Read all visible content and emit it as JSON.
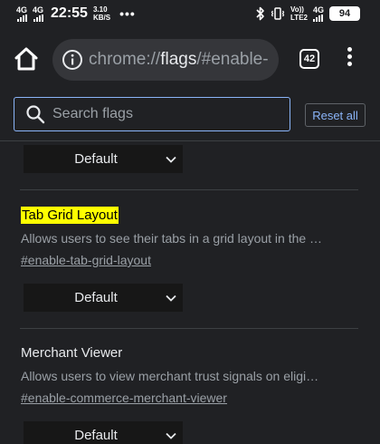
{
  "status_bar": {
    "signal1_label": "4G",
    "signal2_label": "4G",
    "time": "22:55",
    "net_rate_value": "3.10",
    "net_rate_unit": "KB/S",
    "more_dots": "•••",
    "volte_top": "Vo))",
    "volte_bottom": "LTE2",
    "signal3_label": "4G",
    "battery": "94"
  },
  "toolbar": {
    "url_prefix": "chrome://",
    "url_host": "flags",
    "url_suffix": "/#enable-",
    "tab_count": "42"
  },
  "search": {
    "placeholder": "Search flags",
    "value": "",
    "reset_label": "Reset all"
  },
  "flags": [
    {
      "select_value": "Default"
    },
    {
      "title": "Tab Grid Layout",
      "description": "Allows users to see their tabs in a grid layout in the …",
      "link": "#enable-tab-grid-layout",
      "select_value": "Default"
    },
    {
      "title": "Merchant Viewer",
      "description": "Allows users to view merchant trust signals on eligi…",
      "link": "#enable-commerce-merchant-viewer",
      "select_value": "Default"
    }
  ],
  "colors": {
    "background": "#202124",
    "omnibox": "#35363a",
    "accent": "#8ab4f8",
    "highlight": "#ffff00",
    "select_bg": "#171717"
  },
  "icons": [
    "home-icon",
    "info-icon",
    "tab-switcher-icon",
    "menu-icon",
    "search-icon",
    "chevron-down-icon",
    "bluetooth-icon",
    "vibrate-icon",
    "battery-icon"
  ]
}
